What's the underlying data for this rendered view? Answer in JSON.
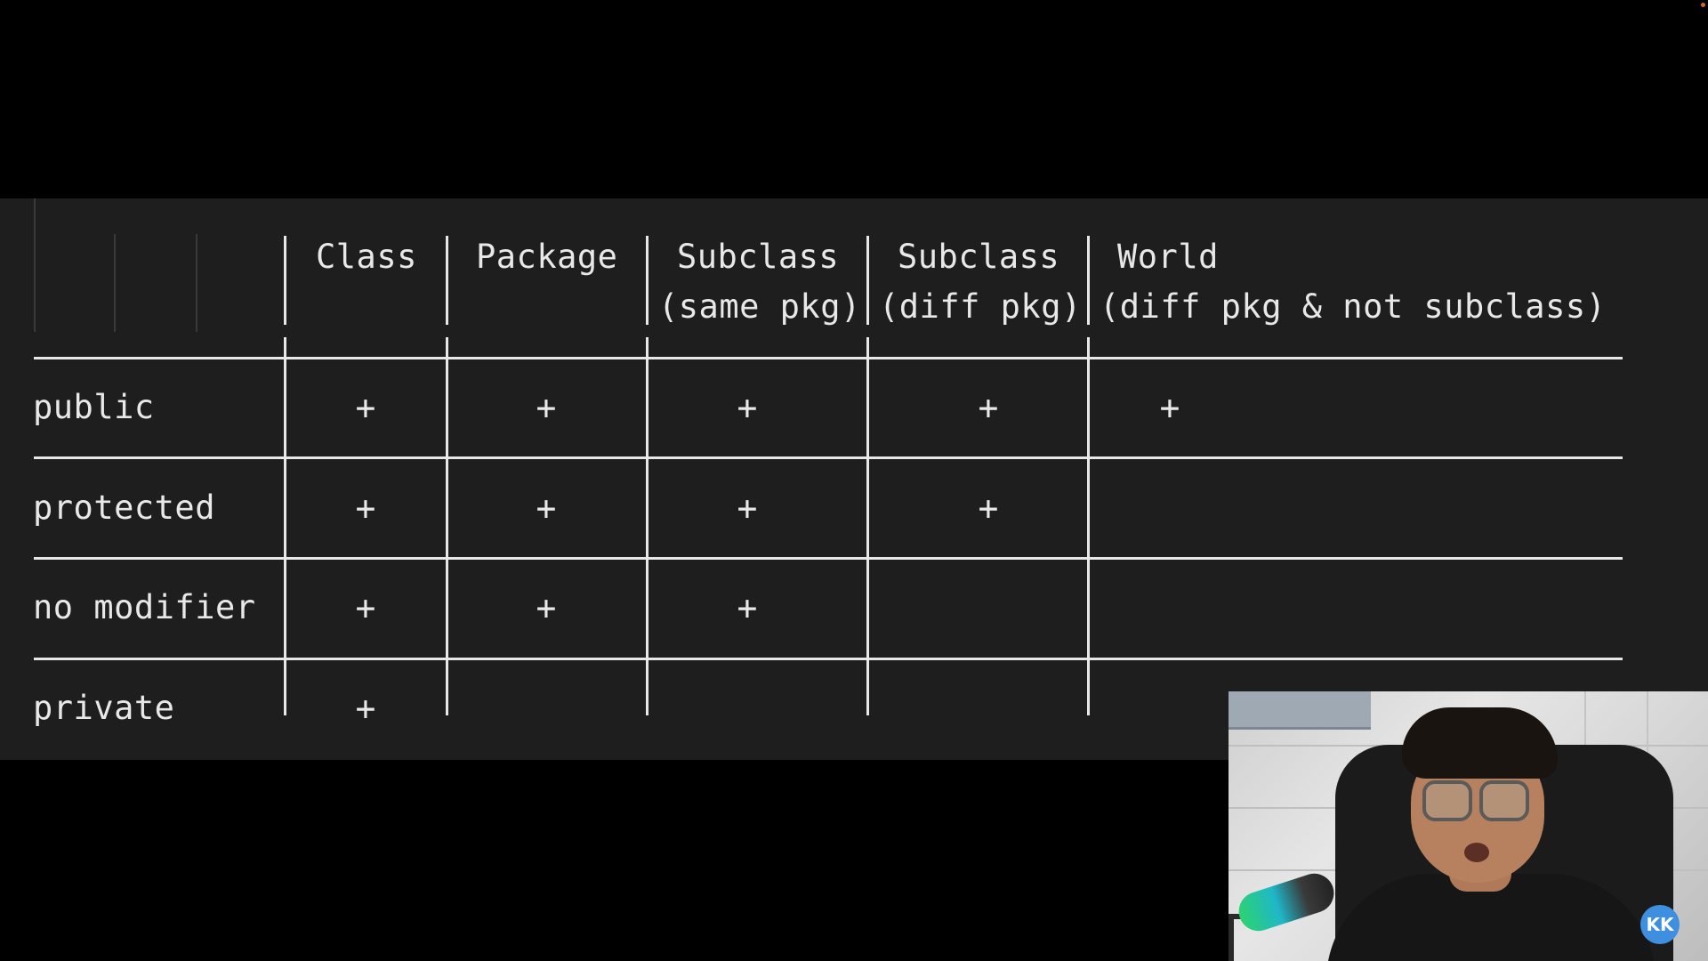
{
  "table": {
    "headers": [
      {
        "line1": "Class",
        "line2": ""
      },
      {
        "line1": "Package",
        "line2": ""
      },
      {
        "line1": "Subclass",
        "line2": "(same pkg)"
      },
      {
        "line1": "Subclass",
        "line2": "(diff pkg)"
      },
      {
        "line1": "World",
        "line2": "(diff pkg & not subclass)"
      }
    ],
    "rows": [
      {
        "modifier": "public",
        "access": [
          "+",
          "+",
          "+",
          "+",
          "+"
        ]
      },
      {
        "modifier": "protected",
        "access": [
          "+",
          "+",
          "+",
          "+",
          ""
        ]
      },
      {
        "modifier": "no modifier",
        "access": [
          "+",
          "+",
          "+",
          "",
          ""
        ]
      },
      {
        "modifier": "private",
        "access": [
          "+",
          "",
          "",
          "",
          ""
        ]
      }
    ]
  },
  "webcam": {
    "badge_text": "KK"
  },
  "colors": {
    "terminal_bg": "#1e1e1e",
    "text": "#e8e8e8",
    "page_bg": "#000000",
    "badge": "#3f8fe0"
  }
}
